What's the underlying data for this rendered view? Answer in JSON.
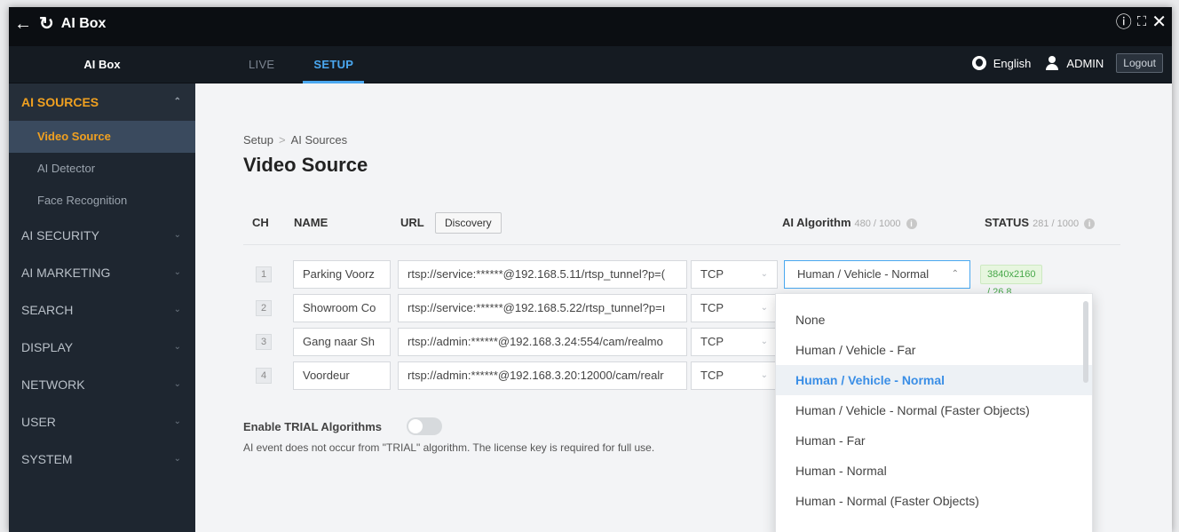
{
  "window": {
    "title": "AI Box"
  },
  "header": {
    "brand": "AI Box",
    "tabs": [
      "LIVE",
      "SETUP"
    ],
    "language": "English",
    "user": "ADMIN",
    "logout": "Logout"
  },
  "sidebar": {
    "groups": [
      {
        "label": "AI SOURCES",
        "items": [
          "Video Source",
          "AI Detector",
          "Face Recognition"
        ]
      },
      {
        "label": "AI SECURITY"
      },
      {
        "label": "AI MARKETING"
      },
      {
        "label": "SEARCH"
      },
      {
        "label": "DISPLAY"
      },
      {
        "label": "NETWORK"
      },
      {
        "label": "USER"
      },
      {
        "label": "SYSTEM"
      }
    ]
  },
  "main": {
    "breadcrumb": [
      "Setup",
      "AI Sources"
    ],
    "title": "Video Source",
    "columns": {
      "ch": "CH",
      "name": "NAME",
      "url": "URL",
      "discovery": "Discovery",
      "ai_algorithm": "AI Algorithm",
      "ai_algorithm_count": "480 / 1000",
      "status": "STATUS",
      "status_count": "281 / 1000"
    },
    "rows": [
      {
        "ch": "1",
        "name": "Parking Voorz",
        "url": "rtsp://service:******@192.168.5.11/rtsp_tunnel?p=(",
        "protocol": "TCP",
        "algorithm": "Human / Vehicle - Normal",
        "status": "3840x2160 / 26.8"
      },
      {
        "ch": "2",
        "name": "Showroom Co",
        "url": "rtsp://service:******@192.168.5.22/rtsp_tunnel?p=ı",
        "protocol": "TCP"
      },
      {
        "ch": "3",
        "name": "Gang naar Sh",
        "url": "rtsp://admin:******@192.168.3.24:554/cam/realmo",
        "protocol": "TCP"
      },
      {
        "ch": "4",
        "name": "Voordeur",
        "url": "rtsp://admin:******@192.168.3.20:12000/cam/realr",
        "protocol": "TCP"
      }
    ],
    "trial": {
      "label": "Enable TRIAL Algorithms",
      "note": "AI event does not occur from \"TRIAL\" algorithm. The license key is required for full use."
    },
    "dropdown_options": [
      "None",
      "Human / Vehicle - Far",
      "Human / Vehicle - Normal",
      "Human / Vehicle - Normal (Faster Objects)",
      "Human - Far",
      "Human - Normal",
      "Human - Normal (Faster Objects)"
    ],
    "dropdown_selected_index": 2
  }
}
